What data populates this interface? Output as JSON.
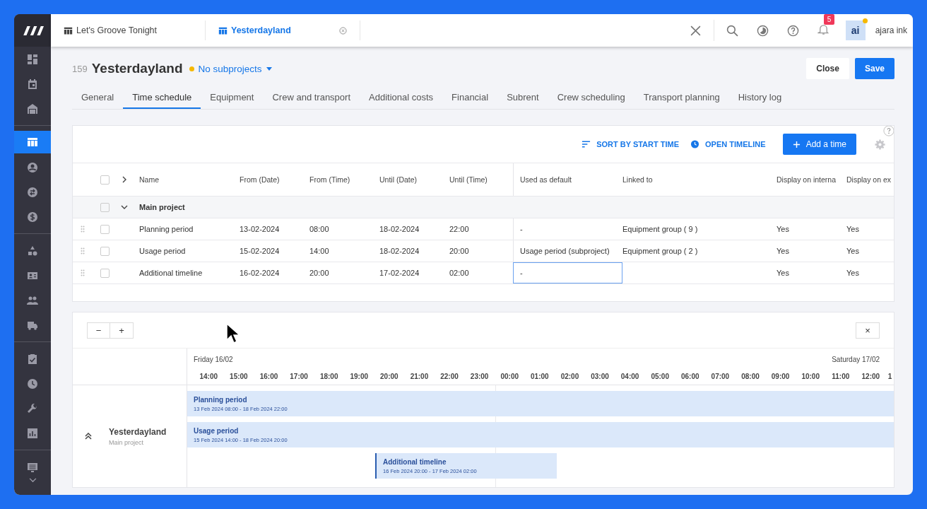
{
  "sidebar": {
    "groups": [
      [
        {
          "kind": "dashboard",
          "selected": false
        },
        {
          "kind": "calendar",
          "selected": false
        },
        {
          "kind": "warehouse",
          "selected": false
        }
      ],
      [
        {
          "kind": "table",
          "selected": true
        },
        {
          "kind": "user",
          "selected": false
        },
        {
          "kind": "exchange",
          "selected": false
        },
        {
          "kind": "dollar",
          "selected": false
        }
      ],
      [
        {
          "kind": "shapes",
          "selected": false
        },
        {
          "kind": "contact-card",
          "selected": false
        },
        {
          "kind": "people",
          "selected": false
        },
        {
          "kind": "truck",
          "selected": false
        }
      ],
      [
        {
          "kind": "clipboard-check",
          "selected": false
        },
        {
          "kind": "clock",
          "selected": false
        },
        {
          "kind": "wrench",
          "selected": false
        },
        {
          "kind": "bar-chart",
          "selected": false
        }
      ],
      [
        {
          "kind": "monitor-list",
          "selected": false
        }
      ]
    ]
  },
  "top_tabs": [
    {
      "label": "Let's Groove Tonight",
      "selected": false
    },
    {
      "label": "Yesterdayland",
      "selected": true
    }
  ],
  "notifications": {
    "count": "5"
  },
  "user": {
    "initials": "ai",
    "name": "ajara ink"
  },
  "project": {
    "number": "159",
    "name": "Yesterdayland",
    "subprojects": "No subprojects"
  },
  "buttons": [
    {
      "label": "Close",
      "kind": "secondary"
    },
    {
      "label": "Save",
      "kind": "primary"
    }
  ],
  "tabs": [
    {
      "label": "General",
      "selected": false
    },
    {
      "label": "Time schedule",
      "selected": true
    },
    {
      "label": "Equipment",
      "selected": false
    },
    {
      "label": "Crew and transport",
      "selected": false
    },
    {
      "label": "Additional costs",
      "selected": false
    },
    {
      "label": "Financial",
      "selected": false
    },
    {
      "label": "Subrent",
      "selected": false
    },
    {
      "label": "Crew scheduling",
      "selected": false
    },
    {
      "label": "Transport planning",
      "selected": false
    },
    {
      "label": "History log",
      "selected": false
    }
  ],
  "toolbar": {
    "sort": "SORT BY START TIME",
    "timeline": "OPEN TIMELINE",
    "add": "Add a time"
  },
  "table": {
    "columns": [
      "Name",
      "From (Date)",
      "From (Time)",
      "Until (Date)",
      "Until (Time)",
      "Used as default",
      "Linked to",
      "Display on interna",
      "Display on ex"
    ],
    "select_all": {
      "checked": false
    },
    "group": {
      "label": "Main project",
      "expanded": true,
      "checked": false
    },
    "rows": [
      {
        "cells": [
          "Planning period",
          "13-02-2024",
          "08:00",
          "18-02-2024",
          "22:00",
          "-",
          "Equipment group ( 9 )",
          "Yes",
          "Yes"
        ],
        "checked": false,
        "focused": false
      },
      {
        "cells": [
          "Usage period",
          "15-02-2024",
          "14:00",
          "18-02-2024",
          "20:00",
          "Usage period (subproject)",
          "Equipment group ( 2 )",
          "Yes",
          "Yes"
        ],
        "checked": false,
        "focused": false
      },
      {
        "cells": [
          "Additional timeline",
          "16-02-2024",
          "20:00",
          "17-02-2024",
          "02:00",
          "-",
          "",
          "Yes",
          "Yes"
        ],
        "checked": false,
        "focused": true
      }
    ]
  },
  "timeline": {
    "zoom_out": "−",
    "zoom_in": "+",
    "close": "×",
    "dates": [
      "Friday 16/02",
      "Saturday 17/02"
    ],
    "hours": [
      "14:00",
      "15:00",
      "16:00",
      "17:00",
      "18:00",
      "19:00",
      "20:00",
      "21:00",
      "22:00",
      "23:00",
      "00:00",
      "01:00",
      "02:00",
      "03:00",
      "04:00",
      "05:00",
      "06:00",
      "07:00",
      "08:00",
      "09:00",
      "10:00",
      "11:00",
      "12:00",
      "1"
    ],
    "project": {
      "name": "Yesterdayland",
      "subtitle": "Main project",
      "expanded": true
    },
    "bars": [
      {
        "title": "Planning period",
        "range": "13 Feb 2024 08:00 - 18 Feb 2024 22:00",
        "kind": "full"
      },
      {
        "title": "Usage period",
        "range": "15 Feb 2024 14:00 - 18 Feb 2024 20:00",
        "kind": "full"
      },
      {
        "title": "Additional timeline",
        "range": "16 Feb 2024 20:00 - 17 Feb 2024 02:00",
        "kind": "partial"
      }
    ]
  }
}
